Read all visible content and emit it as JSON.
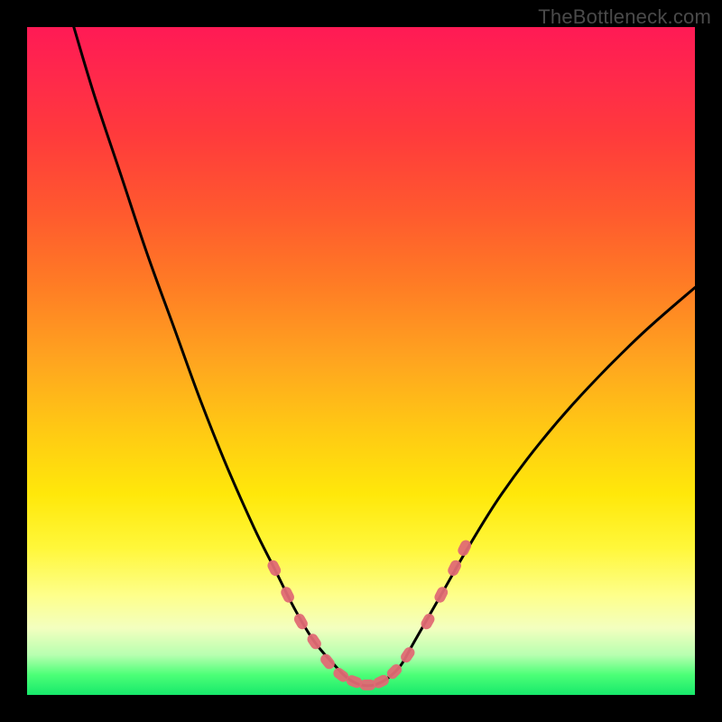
{
  "watermark": "TheBottleneck.com",
  "chart_data": {
    "type": "line",
    "title": "",
    "xlabel": "",
    "ylabel": "",
    "xlim": [
      0,
      100
    ],
    "ylim": [
      0,
      100
    ],
    "series": [
      {
        "name": "curve",
        "x": [
          7,
          10,
          14,
          18,
          22,
          26,
          30,
          34,
          37,
          40,
          43,
          46,
          48,
          50,
          52,
          54,
          56,
          58,
          62,
          66,
          71,
          77,
          84,
          92,
          100
        ],
        "y": [
          100,
          90,
          78,
          66,
          55,
          44,
          34,
          25,
          19,
          13,
          8,
          4.5,
          2.5,
          1.5,
          1.5,
          2.5,
          4.5,
          8,
          15,
          22,
          30,
          38,
          46,
          54,
          61
        ]
      }
    ],
    "markers": [
      {
        "x": 37,
        "y": 19
      },
      {
        "x": 39,
        "y": 15
      },
      {
        "x": 41,
        "y": 11
      },
      {
        "x": 43,
        "y": 8
      },
      {
        "x": 45,
        "y": 5
      },
      {
        "x": 47,
        "y": 3
      },
      {
        "x": 49,
        "y": 2
      },
      {
        "x": 51,
        "y": 1.5
      },
      {
        "x": 53,
        "y": 2
      },
      {
        "x": 55,
        "y": 3.5
      },
      {
        "x": 57,
        "y": 6
      },
      {
        "x": 60,
        "y": 11
      },
      {
        "x": 62,
        "y": 15
      },
      {
        "x": 64,
        "y": 19
      },
      {
        "x": 65.5,
        "y": 22
      }
    ],
    "marker_color": "#e06a74",
    "curve_color": "#000000"
  }
}
